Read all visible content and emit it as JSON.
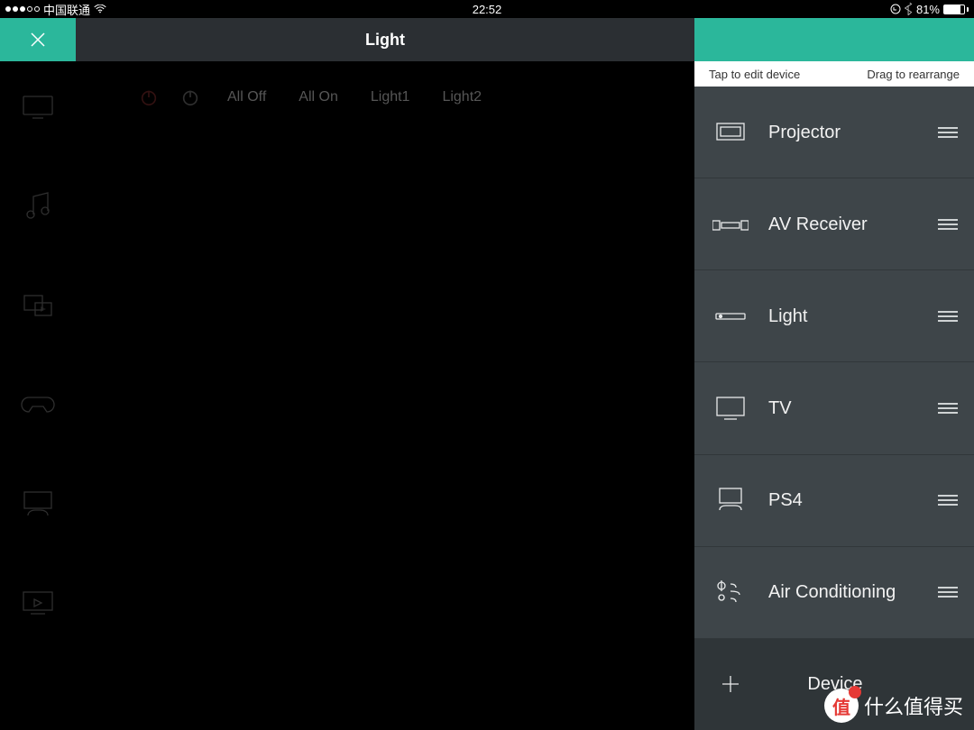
{
  "status": {
    "carrier": "中国联通",
    "time": "22:52",
    "battery_pct": "81%",
    "battery_fill": 81
  },
  "header": {
    "title": "Light"
  },
  "main": {
    "buttons": {
      "all_off": "All Off",
      "all_on": "All On",
      "light1": "Light1",
      "light2": "Light2"
    }
  },
  "panel": {
    "hint_left": "Tap to edit device",
    "hint_right": "Drag to rearrange",
    "devices": [
      {
        "label": "Projector",
        "icon": "projector"
      },
      {
        "label": "AV Receiver",
        "icon": "avr"
      },
      {
        "label": "Light",
        "icon": "light"
      },
      {
        "label": "TV",
        "icon": "tv"
      },
      {
        "label": "PS4",
        "icon": "ps4"
      },
      {
        "label": "Air Conditioning",
        "icon": "ac"
      }
    ],
    "add_label": "Device"
  },
  "watermark": {
    "badge": "值",
    "text": "什么值得买"
  }
}
